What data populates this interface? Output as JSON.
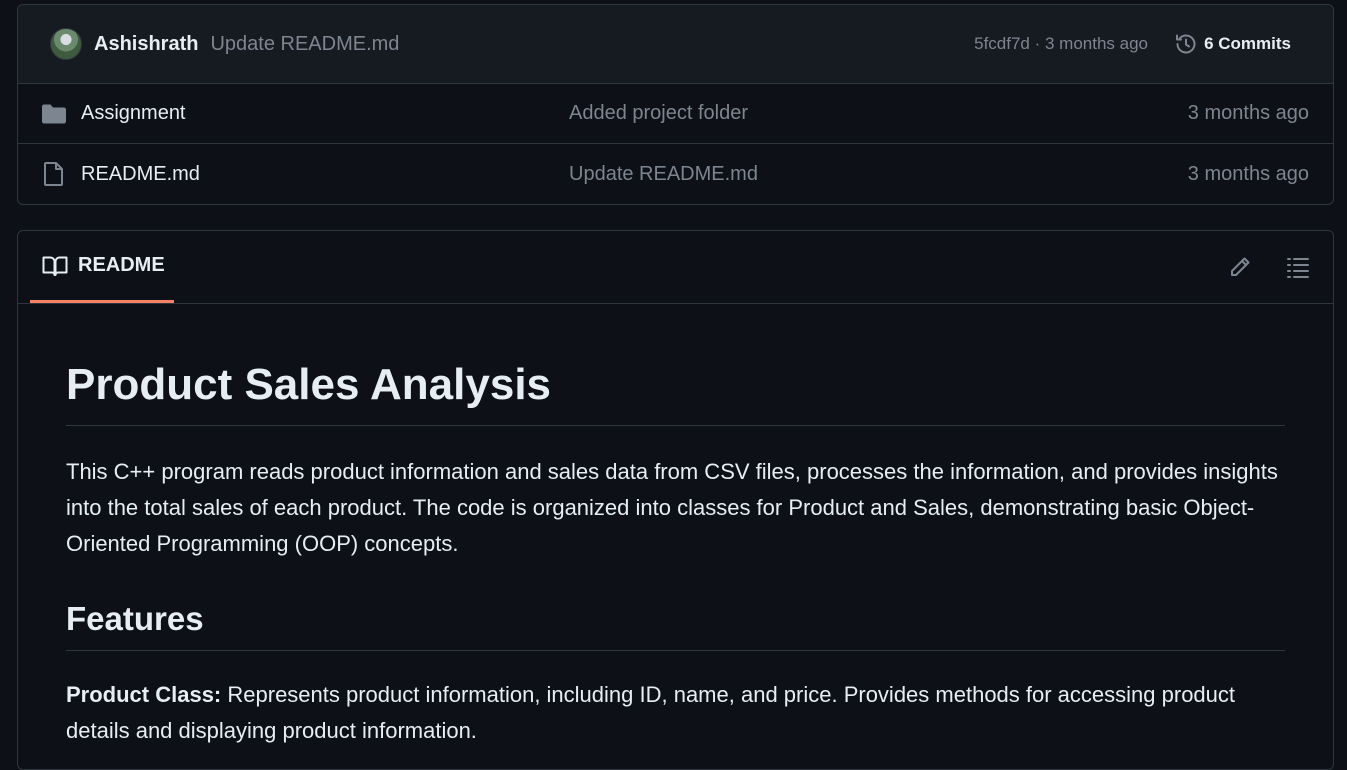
{
  "commit_bar": {
    "author": "Ashishrath",
    "message": "Update README.md",
    "meta": "5fcdf7d · 3 months ago",
    "commits_label": "6 Commits"
  },
  "files": [
    {
      "icon": "folder-icon",
      "name": "Assignment",
      "commit": "Added project folder",
      "age": "3 months ago"
    },
    {
      "icon": "file-icon",
      "name": "README.md",
      "commit": "Update README.md",
      "age": "3 months ago"
    }
  ],
  "readme": {
    "tab_label": "README",
    "title": "Product Sales Analysis",
    "intro": "This C++ program reads product information and sales data from CSV files, processes the information, and provides insights into the total sales of each product. The code is organized into classes for Product and Sales, demonstrating basic Object-Oriented Programming (OOP) concepts.",
    "features_heading": "Features",
    "feature_1_label": "Product Class:",
    "feature_1_text": " Represents product information, including ID, name, and price. Provides methods for accessing product details and displaying product information."
  },
  "colors": {
    "background": "#0d1117",
    "panel": "#161b22",
    "border": "#30363d",
    "muted": "#7d8590",
    "accent_tab": "#f78166"
  }
}
